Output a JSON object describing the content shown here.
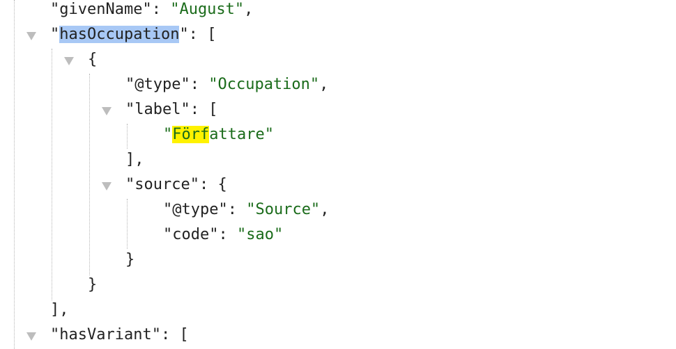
{
  "lines": {
    "givenName_key": "\"givenName\"",
    "givenName_value": "\"August\"",
    "hasOccupation_key": "hasOccupation",
    "open_bracket": "[",
    "open_brace": "{",
    "type_key": "\"@type\"",
    "type_value": "\"Occupation\"",
    "label_key": "\"label\"",
    "label_value_highlight": "Förf",
    "label_value_rest": "attare",
    "close_bracket_comma": "],",
    "source_key": "\"source\"",
    "source_type_key": "\"@type\"",
    "source_type_value": "\"Source\"",
    "code_key": "\"code\"",
    "code_value": "\"sao\"",
    "close_brace": "}",
    "hasVariant_key": "\"hasVariant\""
  },
  "colors": {
    "string": "#1a6b1a",
    "selection": "#a8c8f5",
    "find_highlight": "#fff200"
  },
  "icons": {
    "toggle": "triangle-down-icon"
  }
}
